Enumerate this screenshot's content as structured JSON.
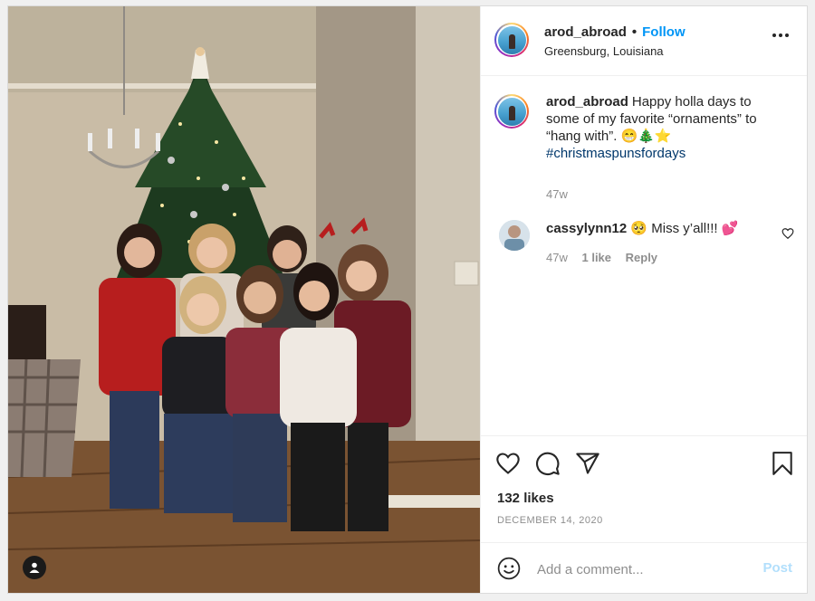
{
  "post": {
    "author": {
      "username": "arod_abroad",
      "follow_label": "Follow",
      "separator": "•",
      "location": "Greensburg, Louisiana"
    },
    "caption": {
      "username": "arod_abroad",
      "text": "Happy holla days to some of my favorite “ornaments” to “hang with”. 😁🎄⭐",
      "hashtag": "#christmaspunsfordays",
      "time": "47w"
    },
    "comments": [
      {
        "username": "cassylynn12",
        "text": "🥺 Miss y’all!!! 💕",
        "time": "47w",
        "likes": "1 like",
        "reply_label": "Reply"
      }
    ],
    "likes": "132 likes",
    "date": "DECEMBER 14, 2020",
    "add_comment_placeholder": "Add a comment...",
    "post_label": "Post"
  },
  "icons": {
    "more": "more-options-icon",
    "like": "heart-icon",
    "comment": "comment-icon",
    "share": "share-icon",
    "save": "bookmark-icon",
    "emoji": "emoji-icon",
    "tag": "user-tag-icon"
  },
  "colors": {
    "accent": "#0095f6",
    "hashtag": "#00376b",
    "muted": "#8e8e8e",
    "post_disabled": "#b2dffc"
  }
}
